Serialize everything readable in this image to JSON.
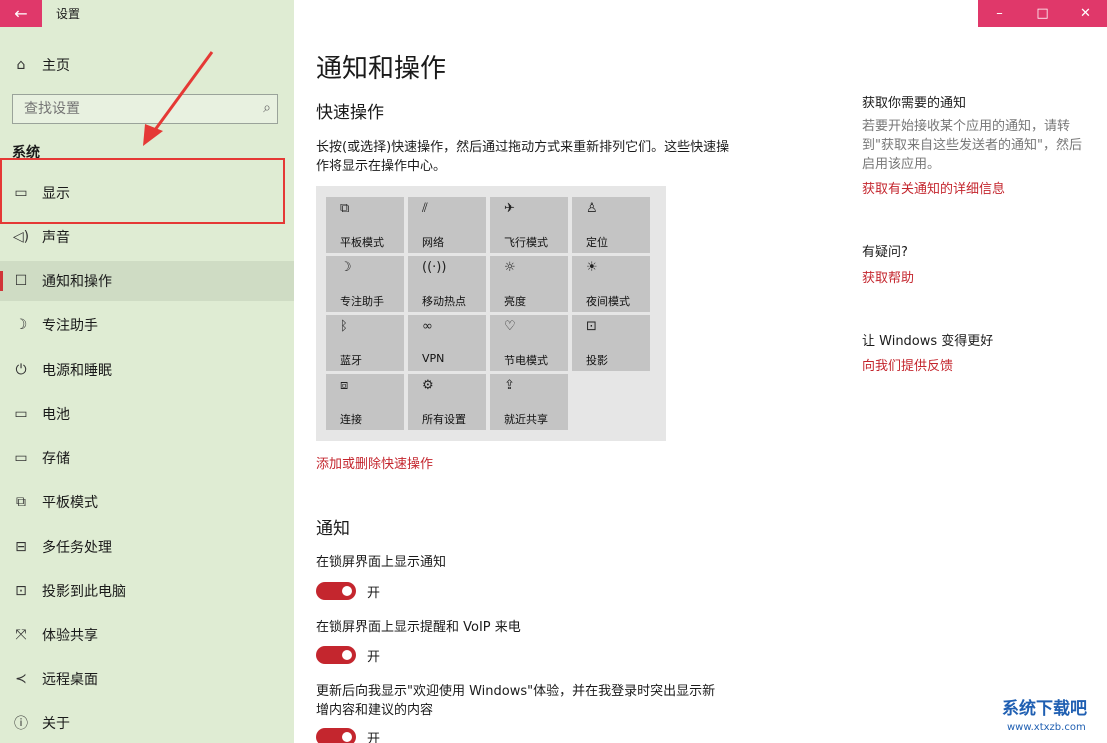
{
  "app": {
    "title": "设置",
    "back_icon": "←"
  },
  "window_controls": {
    "minimize": "–",
    "maximize": "□",
    "close": "✕"
  },
  "sidebar": {
    "home": {
      "icon": "⌂",
      "label": "主页"
    },
    "search": {
      "placeholder": "查找设置",
      "icon": "⌕"
    },
    "section_label": "系统",
    "items": [
      {
        "icon": "▭",
        "label": "显示"
      },
      {
        "icon": "◁)",
        "label": "声音"
      },
      {
        "icon": "☐",
        "label": "通知和操作",
        "selected": true
      },
      {
        "icon": "☽",
        "label": "专注助手"
      },
      {
        "icon": "⏻",
        "label": "电源和睡眠"
      },
      {
        "icon": "▭",
        "label": "电池"
      },
      {
        "icon": "▭",
        "label": "存储"
      },
      {
        "icon": "⧉",
        "label": "平板模式"
      },
      {
        "icon": "⊟",
        "label": "多任务处理"
      },
      {
        "icon": "⊡",
        "label": "投影到此电脑"
      },
      {
        "icon": "⤧",
        "label": "体验共享"
      },
      {
        "icon": "≺",
        "label": "远程桌面"
      },
      {
        "icon": "ⓘ",
        "label": "关于"
      }
    ]
  },
  "main": {
    "page_title": "通知和操作",
    "quick_actions": {
      "heading": "快速操作",
      "description": "长按(或选择)快速操作，然后通过拖动方式来重新排列它们。这些快速操作将显示在操作中心。",
      "tiles": [
        {
          "icon": "⧉",
          "label": "平板模式"
        },
        {
          "icon": "⫽",
          "label": "网络"
        },
        {
          "icon": "✈",
          "label": "飞行模式"
        },
        {
          "icon": "♙",
          "label": "定位"
        },
        {
          "icon": "☽",
          "label": "专注助手"
        },
        {
          "icon": "((·))",
          "label": "移动热点"
        },
        {
          "icon": "☼",
          "label": "亮度"
        },
        {
          "icon": "☀",
          "label": "夜间模式"
        },
        {
          "icon": "ᛒ",
          "label": "蓝牙"
        },
        {
          "icon": "∞",
          "label": "VPN"
        },
        {
          "icon": "♡",
          "label": "节电模式"
        },
        {
          "icon": "⊡",
          "label": "投影"
        },
        {
          "icon": "⧈",
          "label": "连接"
        },
        {
          "icon": "⚙",
          "label": "所有设置"
        },
        {
          "icon": "⇪",
          "label": "就近共享"
        }
      ],
      "link": "添加或删除快速操作"
    },
    "notifications": {
      "heading": "通知",
      "settings": [
        {
          "label": "在锁屏界面上显示通知",
          "state": "开"
        },
        {
          "label": "在锁屏界面上显示提醒和 VoIP 来电",
          "state": "开"
        },
        {
          "label": "更新后向我显示\"欢迎使用 Windows\"体验，并在我登录时突出显示新增内容和建议的内容",
          "state": "开"
        }
      ]
    }
  },
  "right_column": {
    "section1": {
      "heading": "获取你需要的通知",
      "text": "若要开始接收某个应用的通知，请转到\"获取来自这些发送者的通知\"，然后启用该应用。",
      "link": "获取有关通知的详细信息"
    },
    "section2": {
      "heading": "有疑问?",
      "link": "获取帮助"
    },
    "section3": {
      "heading": "让 Windows 变得更好",
      "link": "向我们提供反馈"
    }
  },
  "watermark": {
    "title": "系统下载吧",
    "url": "www.xtxzb.com"
  },
  "colors": {
    "accent": "#c4262e",
    "titlebar": "#e0386a",
    "sidebar_bg": "#dfecd3",
    "annotation": "#e53935"
  }
}
